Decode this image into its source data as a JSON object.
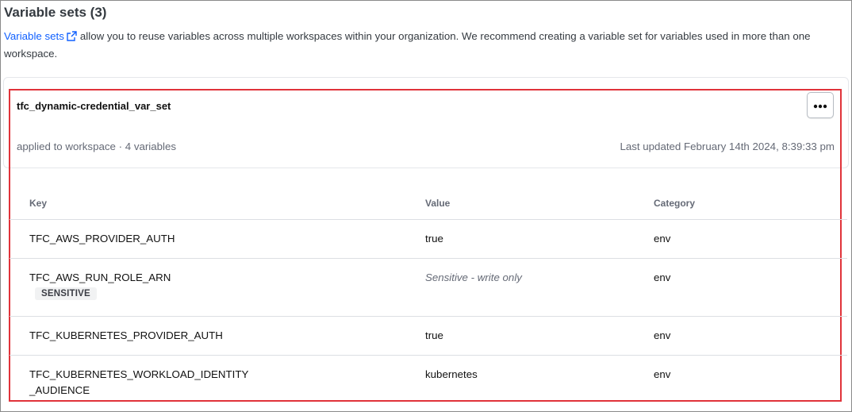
{
  "section": {
    "title": "Variable sets (3)",
    "desc_link": "Variable sets",
    "desc_text": "allow you to reuse variables across multiple workspaces within your organization. We recommend creating a variable set for variables used in more than one workspace."
  },
  "varset": {
    "name": "tfc_dynamic-credential_var_set",
    "meta": "applied to workspace · 4 variables",
    "updated": "Last updated February 14th 2024, 8:39:33 pm",
    "more_label": "•••"
  },
  "table": {
    "headers": [
      "Key",
      "Value",
      "Category"
    ],
    "rows": [
      {
        "key": "TFC_AWS_PROVIDER_AUTH",
        "value": "true",
        "category": "env"
      },
      {
        "key": "TFC_AWS_RUN_ROLE_ARN",
        "value": "Sensitive - write only",
        "category": "env",
        "badge": "SENSITIVE"
      },
      {
        "key": "TFC_KUBERNETES_PROVIDER_AUTH",
        "value": "true",
        "category": "env"
      },
      {
        "key": "TFC_KUBERNETES_WORKLOAD_IDENTITY\n_AUDIENCE",
        "value": "kubernetes",
        "category": "env"
      }
    ]
  },
  "colors": {
    "highlight": "#e0333a",
    "link": "#1060ff"
  }
}
